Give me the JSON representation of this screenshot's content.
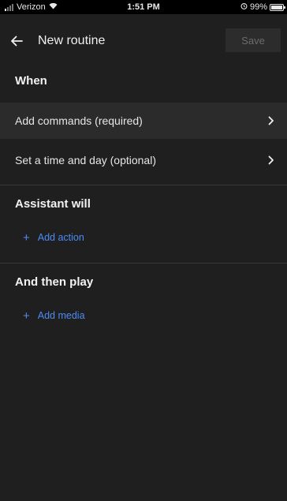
{
  "status_bar": {
    "carrier": "Verizon",
    "time": "1:51 PM",
    "battery": "99%",
    "battery_level": 0.99
  },
  "app_bar": {
    "title": "New routine",
    "save_label": "Save"
  },
  "when": {
    "heading": "When",
    "items": [
      {
        "label": "Add commands (required)"
      },
      {
        "label": "Set a time and day (optional)"
      }
    ]
  },
  "assistant": {
    "heading": "Assistant will",
    "add_label": "Add action"
  },
  "then_play": {
    "heading": "And then play",
    "add_label": "Add media"
  },
  "colors": {
    "background": "#1f1f1f",
    "highlight_row": "#2b2b2b",
    "accent": "#4d8bf5",
    "save_disabled_bg": "#2c2c2c",
    "save_disabled_text": "#6c6c6c"
  }
}
